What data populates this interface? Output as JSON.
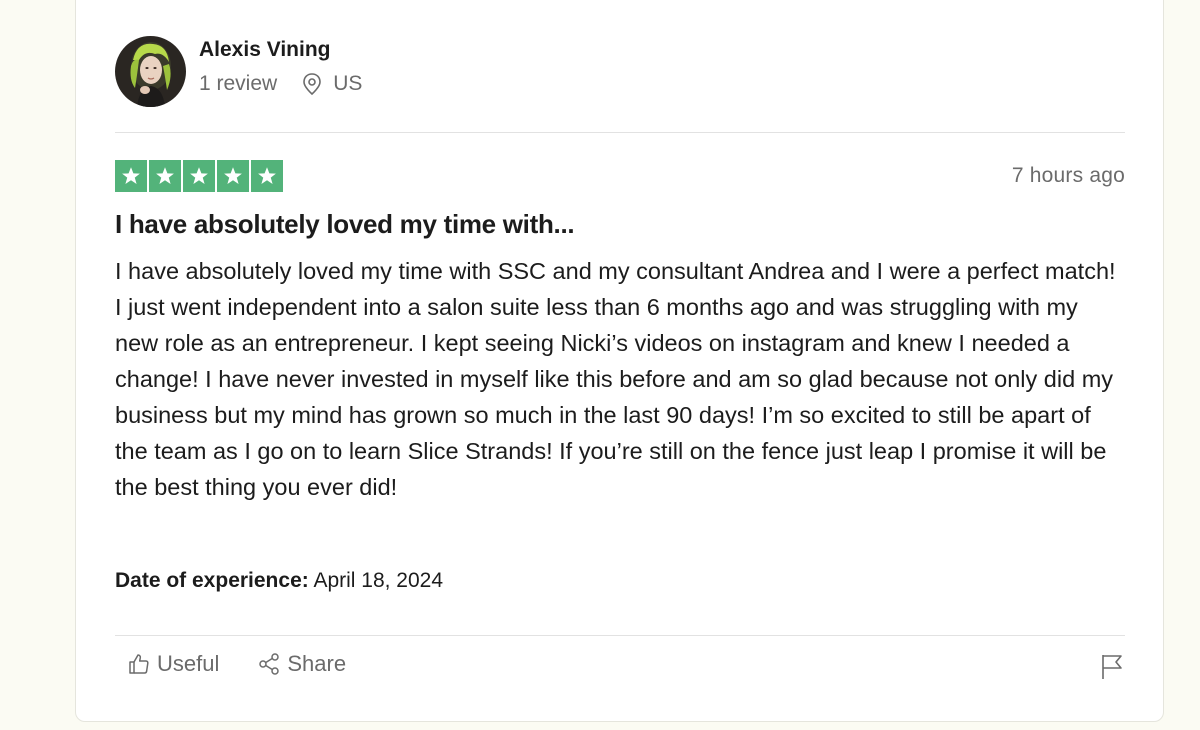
{
  "reviewer": {
    "name": "Alexis Vining",
    "review_count": "1 review",
    "country": "US",
    "avatar_icon": "reviewer-avatar-photo"
  },
  "review": {
    "rating": 5,
    "max_rating": 5,
    "star_color": "#53b37a",
    "posted": "7 hours ago",
    "title": "I have absolutely loved my time with...",
    "body": "I have absolutely loved my time with SSC and my consultant Andrea and I were a perfect match! I just went independent into a salon suite less than 6 months ago and was struggling with my new role as an entrepreneur. I kept seeing Nicki’s videos on instagram and knew I needed a change! I have never invested in myself like this before and am so glad because not only did my business but my mind has grown so much in the last 90 days! I’m so excited to still be apart of the team as I go on to learn Slice Strands! If you’re still on the fence just leap I promise it will be the best thing you ever did!",
    "experience_label": "Date of experience:",
    "experience_date": "April 18, 2024"
  },
  "actions": {
    "useful_label": "Useful",
    "share_label": "Share",
    "useful_icon": "thumbs-up-icon",
    "share_icon": "share-icon",
    "flag_icon": "flag-icon"
  },
  "colors": {
    "page_background": "#fbfbf3",
    "card_background": "#ffffff",
    "muted_text": "#6b6b6b",
    "primary_text": "#1c1c1c"
  }
}
